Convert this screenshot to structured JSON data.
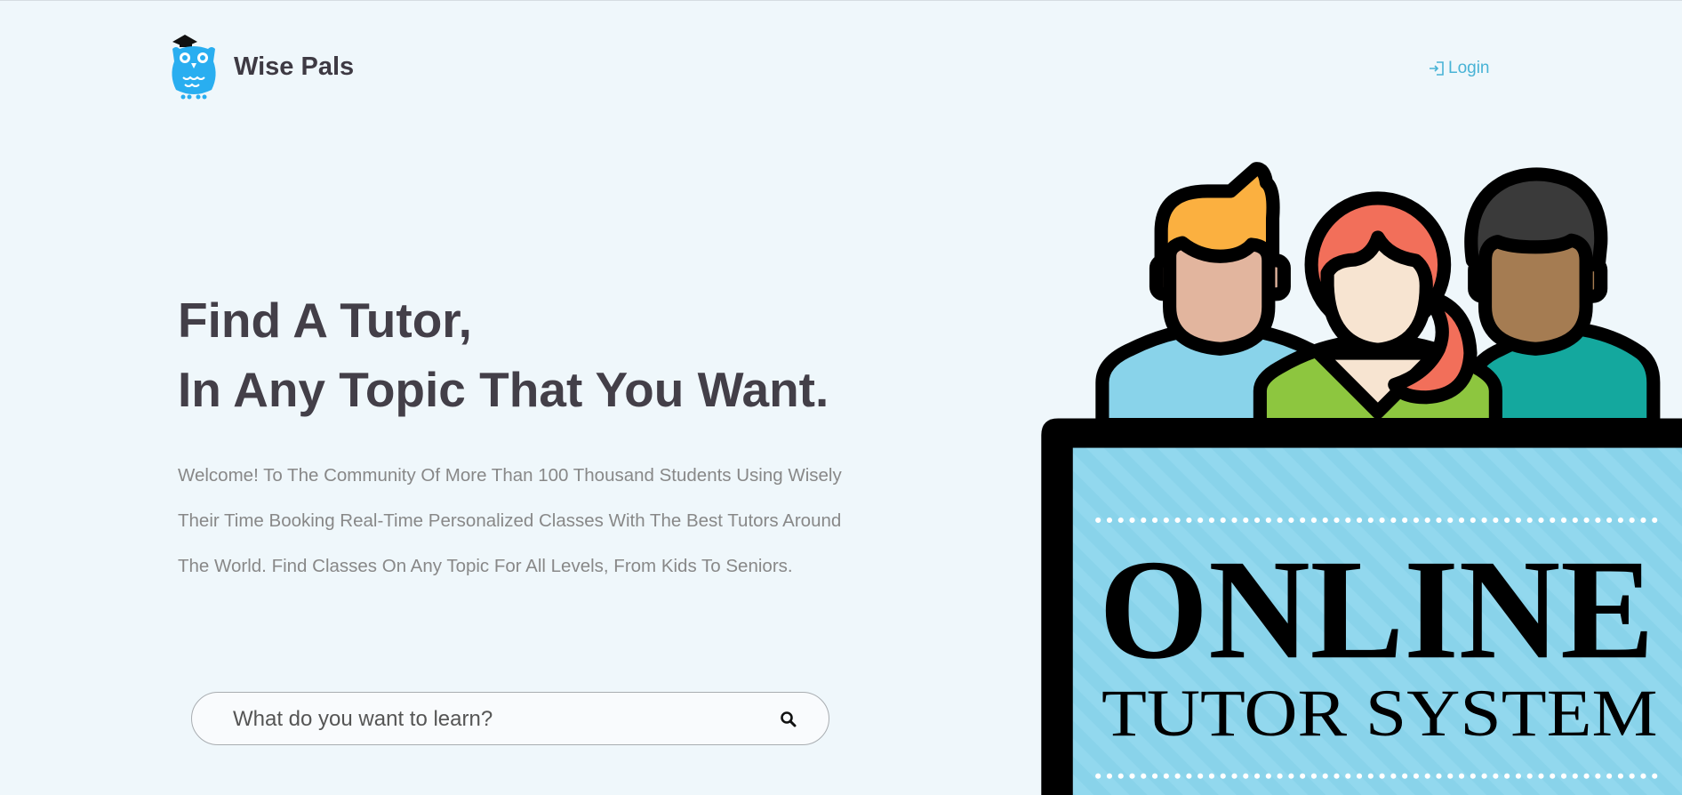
{
  "header": {
    "brand": "Wise Pals",
    "logo_icon": "owl-graduation-cap-icon",
    "login_label": "Login",
    "login_icon": "sign-in-icon"
  },
  "hero": {
    "title_line1": "Find A Tutor,",
    "title_line2": "In Any Topic That You Want.",
    "description": "Welcome! To The Community Of More Than 100 Thousand Students Using Wisely Their Time Booking Real-Time Personalized Classes With The Best Tutors Around The World. Find Classes On Any Topic For All Levels, From Kids To Seniors."
  },
  "search": {
    "placeholder": "What do you want to learn?",
    "value": "",
    "icon": "search-icon"
  },
  "illustration": {
    "headline": "ONLINE",
    "subheadline": "TUTOR SYSTEM"
  },
  "colors": {
    "background": "#eff7fb",
    "accent": "#48b3d6",
    "logo": "#29aef0",
    "heading": "#433f48",
    "screen": "#89d3ea"
  }
}
